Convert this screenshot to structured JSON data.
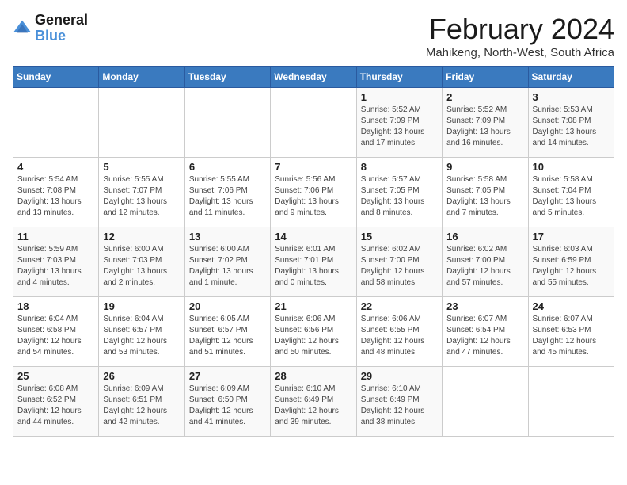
{
  "logo": {
    "line1": "General",
    "line2": "Blue"
  },
  "title": "February 2024",
  "subtitle": "Mahikeng, North-West, South Africa",
  "days_of_week": [
    "Sunday",
    "Monday",
    "Tuesday",
    "Wednesday",
    "Thursday",
    "Friday",
    "Saturday"
  ],
  "weeks": [
    [
      {
        "day": "",
        "info": ""
      },
      {
        "day": "",
        "info": ""
      },
      {
        "day": "",
        "info": ""
      },
      {
        "day": "",
        "info": ""
      },
      {
        "day": "1",
        "info": "Sunrise: 5:52 AM\nSunset: 7:09 PM\nDaylight: 13 hours\nand 17 minutes."
      },
      {
        "day": "2",
        "info": "Sunrise: 5:52 AM\nSunset: 7:09 PM\nDaylight: 13 hours\nand 16 minutes."
      },
      {
        "day": "3",
        "info": "Sunrise: 5:53 AM\nSunset: 7:08 PM\nDaylight: 13 hours\nand 14 minutes."
      }
    ],
    [
      {
        "day": "4",
        "info": "Sunrise: 5:54 AM\nSunset: 7:08 PM\nDaylight: 13 hours\nand 13 minutes."
      },
      {
        "day": "5",
        "info": "Sunrise: 5:55 AM\nSunset: 7:07 PM\nDaylight: 13 hours\nand 12 minutes."
      },
      {
        "day": "6",
        "info": "Sunrise: 5:55 AM\nSunset: 7:06 PM\nDaylight: 13 hours\nand 11 minutes."
      },
      {
        "day": "7",
        "info": "Sunrise: 5:56 AM\nSunset: 7:06 PM\nDaylight: 13 hours\nand 9 minutes."
      },
      {
        "day": "8",
        "info": "Sunrise: 5:57 AM\nSunset: 7:05 PM\nDaylight: 13 hours\nand 8 minutes."
      },
      {
        "day": "9",
        "info": "Sunrise: 5:58 AM\nSunset: 7:05 PM\nDaylight: 13 hours\nand 7 minutes."
      },
      {
        "day": "10",
        "info": "Sunrise: 5:58 AM\nSunset: 7:04 PM\nDaylight: 13 hours\nand 5 minutes."
      }
    ],
    [
      {
        "day": "11",
        "info": "Sunrise: 5:59 AM\nSunset: 7:03 PM\nDaylight: 13 hours\nand 4 minutes."
      },
      {
        "day": "12",
        "info": "Sunrise: 6:00 AM\nSunset: 7:03 PM\nDaylight: 13 hours\nand 2 minutes."
      },
      {
        "day": "13",
        "info": "Sunrise: 6:00 AM\nSunset: 7:02 PM\nDaylight: 13 hours\nand 1 minute."
      },
      {
        "day": "14",
        "info": "Sunrise: 6:01 AM\nSunset: 7:01 PM\nDaylight: 13 hours\nand 0 minutes."
      },
      {
        "day": "15",
        "info": "Sunrise: 6:02 AM\nSunset: 7:00 PM\nDaylight: 12 hours\nand 58 minutes."
      },
      {
        "day": "16",
        "info": "Sunrise: 6:02 AM\nSunset: 7:00 PM\nDaylight: 12 hours\nand 57 minutes."
      },
      {
        "day": "17",
        "info": "Sunrise: 6:03 AM\nSunset: 6:59 PM\nDaylight: 12 hours\nand 55 minutes."
      }
    ],
    [
      {
        "day": "18",
        "info": "Sunrise: 6:04 AM\nSunset: 6:58 PM\nDaylight: 12 hours\nand 54 minutes."
      },
      {
        "day": "19",
        "info": "Sunrise: 6:04 AM\nSunset: 6:57 PM\nDaylight: 12 hours\nand 53 minutes."
      },
      {
        "day": "20",
        "info": "Sunrise: 6:05 AM\nSunset: 6:57 PM\nDaylight: 12 hours\nand 51 minutes."
      },
      {
        "day": "21",
        "info": "Sunrise: 6:06 AM\nSunset: 6:56 PM\nDaylight: 12 hours\nand 50 minutes."
      },
      {
        "day": "22",
        "info": "Sunrise: 6:06 AM\nSunset: 6:55 PM\nDaylight: 12 hours\nand 48 minutes."
      },
      {
        "day": "23",
        "info": "Sunrise: 6:07 AM\nSunset: 6:54 PM\nDaylight: 12 hours\nand 47 minutes."
      },
      {
        "day": "24",
        "info": "Sunrise: 6:07 AM\nSunset: 6:53 PM\nDaylight: 12 hours\nand 45 minutes."
      }
    ],
    [
      {
        "day": "25",
        "info": "Sunrise: 6:08 AM\nSunset: 6:52 PM\nDaylight: 12 hours\nand 44 minutes."
      },
      {
        "day": "26",
        "info": "Sunrise: 6:09 AM\nSunset: 6:51 PM\nDaylight: 12 hours\nand 42 minutes."
      },
      {
        "day": "27",
        "info": "Sunrise: 6:09 AM\nSunset: 6:50 PM\nDaylight: 12 hours\nand 41 minutes."
      },
      {
        "day": "28",
        "info": "Sunrise: 6:10 AM\nSunset: 6:49 PM\nDaylight: 12 hours\nand 39 minutes."
      },
      {
        "day": "29",
        "info": "Sunrise: 6:10 AM\nSunset: 6:49 PM\nDaylight: 12 hours\nand 38 minutes."
      },
      {
        "day": "",
        "info": ""
      },
      {
        "day": "",
        "info": ""
      }
    ]
  ]
}
